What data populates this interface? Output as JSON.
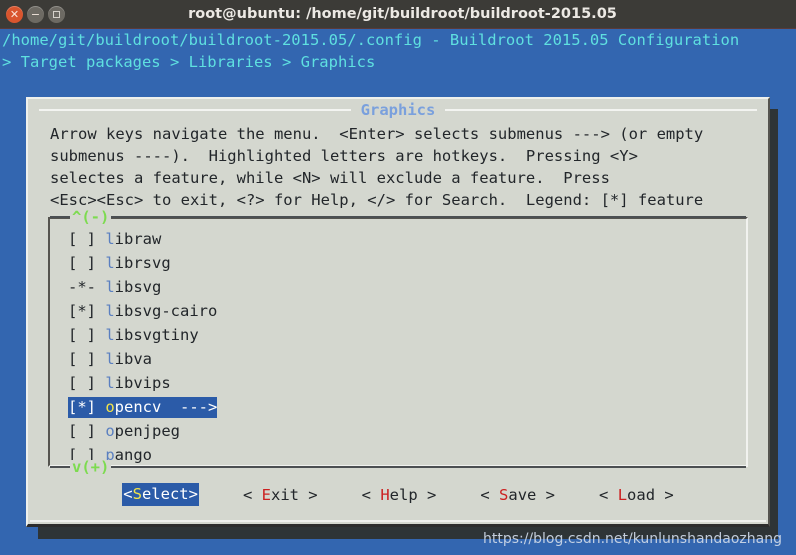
{
  "window": {
    "title": "root@ubuntu: /home/git/buildroot/buildroot-2015.05",
    "close_glyph": "✕",
    "minimize_glyph": "−",
    "maximize_glyph": ""
  },
  "terminal": {
    "header_line_1": "/home/git/buildroot/buildroot-2015.05/.config - Buildroot 2015.05 Configuration",
    "header_line_2": "> Target packages > Libraries > Graphics",
    "fg_color": "#5fe0e0",
    "bg_color": "#3366b0"
  },
  "dialog": {
    "title": "Graphics",
    "title_color": "#7aa0dd",
    "bg_color": "#d4d7cf",
    "help_text": "Arrow keys navigate the menu.  <Enter> selects submenus ---> (or empty\nsubmenus ----).  Highlighted letters are hotkeys.  Pressing <Y>\nselectes a feature, while <N> will exclude a feature.  Press\n<Esc><Esc> to exit, <?> for Help, </> for Search.  Legend: [*] feature"
  },
  "listbox": {
    "scroll_up_indicator": "^(-)",
    "scroll_down_indicator": "v(+)",
    "indicator_color": "#7ddb50",
    "selection_bg": "#2b5ba8",
    "selection_fg": "#ffffff",
    "hotkey_color": "#5a7fc0",
    "selected_hotkey_color": "#f2e44a",
    "items": [
      {
        "mark": "[ ]",
        "hotkey": "l",
        "rest": "ibraw",
        "arrow": "",
        "selected": false
      },
      {
        "mark": "[ ]",
        "hotkey": "l",
        "rest": "ibrsvg",
        "arrow": "",
        "selected": false
      },
      {
        "mark": "-*-",
        "hotkey": "l",
        "rest": "ibsvg",
        "arrow": "",
        "selected": false
      },
      {
        "mark": "[*]",
        "hotkey": "l",
        "rest": "ibsvg-cairo",
        "arrow": "",
        "selected": false
      },
      {
        "mark": "[ ]",
        "hotkey": "l",
        "rest": "ibsvgtiny",
        "arrow": "",
        "selected": false
      },
      {
        "mark": "[ ]",
        "hotkey": "l",
        "rest": "ibva",
        "arrow": "",
        "selected": false
      },
      {
        "mark": "[ ]",
        "hotkey": "l",
        "rest": "ibvips",
        "arrow": "",
        "selected": false
      },
      {
        "mark": "[*]",
        "hotkey": "o",
        "rest": "pencv",
        "arrow": "  --->",
        "selected": true
      },
      {
        "mark": "[ ]",
        "hotkey": "o",
        "rest": "penjpeg",
        "arrow": "",
        "selected": false
      },
      {
        "mark": "[ ]",
        "hotkey": "p",
        "rest": "ango",
        "arrow": "",
        "selected": false
      }
    ]
  },
  "buttons": [
    {
      "pre": "<",
      "hotkey": "S",
      "post": "elect>",
      "active": true
    },
    {
      "pre": "< ",
      "hotkey": "E",
      "post": "xit >",
      "active": false
    },
    {
      "pre": "< ",
      "hotkey": "H",
      "post": "elp >",
      "active": false
    },
    {
      "pre": "< ",
      "hotkey": "S",
      "post": "ave >",
      "active": false
    },
    {
      "pre": "< ",
      "hotkey": "L",
      "post": "oad >",
      "active": false
    }
  ],
  "watermark": "https://blog.csdn.net/kunlunshandaozhang"
}
